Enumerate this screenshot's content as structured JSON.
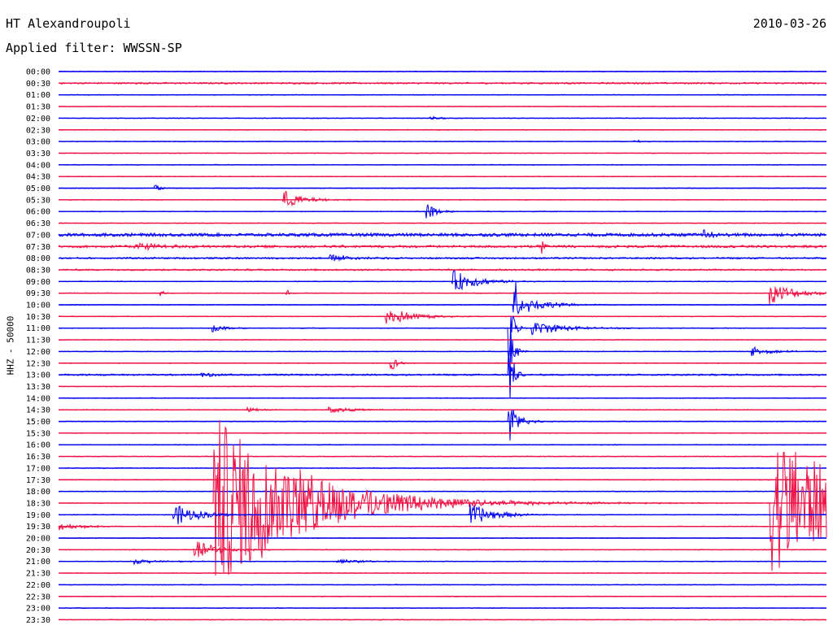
{
  "header": {
    "station": "HT Alexandroupoli",
    "date": "2010-03-26",
    "filter": "Applied filter: WWSSN-SP"
  },
  "channel_label": "HHZ - 50000",
  "colors": {
    "even_trace": "#0000ee",
    "odd_trace": "#ee1144"
  },
  "chart_data": {
    "type": "line",
    "title": "HT Alexandroupoli",
    "xlabel": "",
    "ylabel": "HHZ - 50000",
    "categories": [
      "00:00",
      "00:30",
      "01:00",
      "01:30",
      "02:00",
      "02:30",
      "03:00",
      "03:30",
      "04:00",
      "04:30",
      "05:00",
      "05:30",
      "06:00",
      "06:30",
      "07:00",
      "07:30",
      "08:00",
      "08:30",
      "09:00",
      "09:30",
      "10:00",
      "10:30",
      "11:00",
      "11:30",
      "12:00",
      "12:30",
      "13:00",
      "13:30",
      "14:00",
      "14:30",
      "15:00",
      "15:30",
      "16:00",
      "16:30",
      "17:00",
      "17:30",
      "18:00",
      "18:30",
      "19:00",
      "19:30",
      "20:00",
      "20:30",
      "21:00",
      "21:30",
      "22:00",
      "22:30",
      "23:00",
      "23:30"
    ],
    "trace_minutes": 30,
    "grid": false,
    "noise_level": [
      1,
      2,
      1,
      1,
      1,
      1,
      1,
      1,
      1,
      1,
      1,
      1,
      1,
      1,
      4,
      3,
      2,
      2,
      1,
      1,
      1,
      1,
      1,
      1,
      1,
      1,
      2,
      1,
      1,
      1,
      1,
      1,
      1,
      1,
      1,
      1,
      1,
      1,
      1,
      1,
      1,
      1,
      1,
      1,
      1,
      1,
      1,
      1
    ],
    "events": [
      {
        "trace": "02:00",
        "minute": 14.5,
        "amplitude": 2,
        "duration_min": 1
      },
      {
        "trace": "03:00",
        "minute": 22.5,
        "amplitude": 2,
        "duration_min": 0.5
      },
      {
        "trace": "05:00",
        "minute": 3.8,
        "amplitude": 6,
        "duration_min": 0.2
      },
      {
        "trace": "05:30",
        "minute": 8.8,
        "amplitude": 12,
        "duration_min": 1.5
      },
      {
        "trace": "06:00",
        "minute": 14.4,
        "amplitude": 12,
        "duration_min": 0.6
      },
      {
        "trace": "07:00",
        "minute": 25.2,
        "amplitude": 6,
        "duration_min": 1
      },
      {
        "trace": "07:30",
        "minute": 3.0,
        "amplitude": 6,
        "duration_min": 2
      },
      {
        "trace": "07:30",
        "minute": 18.9,
        "amplitude": 8,
        "duration_min": 0.2
      },
      {
        "trace": "08:00",
        "minute": 10.6,
        "amplitude": 5,
        "duration_min": 2
      },
      {
        "trace": "09:00",
        "minute": 15.4,
        "amplitude": 14,
        "duration_min": 2
      },
      {
        "trace": "09:30",
        "minute": 4.0,
        "amplitude": 5,
        "duration_min": 0.2
      },
      {
        "trace": "09:30",
        "minute": 8.9,
        "amplitude": 5,
        "duration_min": 0.2
      },
      {
        "trace": "09:30",
        "minute": 27.8,
        "amplitude": 14,
        "duration_min": 2
      },
      {
        "trace": "10:00",
        "minute": 17.8,
        "amplitude": 46,
        "duration_min": 0.25
      },
      {
        "trace": "10:00",
        "minute": 18.4,
        "amplitude": 8,
        "duration_min": 2
      },
      {
        "trace": "10:30",
        "minute": 12.8,
        "amplitude": 12,
        "duration_min": 2
      },
      {
        "trace": "11:00",
        "minute": 6.0,
        "amplitude": 5,
        "duration_min": 1
      },
      {
        "trace": "11:00",
        "minute": 17.6,
        "amplitude": 46,
        "duration_min": 0.25
      },
      {
        "trace": "11:00",
        "minute": 18.5,
        "amplitude": 8,
        "duration_min": 3
      },
      {
        "trace": "12:00",
        "minute": 17.6,
        "amplitude": 46,
        "duration_min": 0.25
      },
      {
        "trace": "12:00",
        "minute": 27.1,
        "amplitude": 6,
        "duration_min": 1.5
      },
      {
        "trace": "12:30",
        "minute": 13.0,
        "amplitude": 10,
        "duration_min": 0.4
      },
      {
        "trace": "13:00",
        "minute": 17.6,
        "amplitude": 46,
        "duration_min": 0.25
      },
      {
        "trace": "13:00",
        "minute": 5.6,
        "amplitude": 3,
        "duration_min": 1
      },
      {
        "trace": "14:30",
        "minute": 7.4,
        "amplitude": 3,
        "duration_min": 1
      },
      {
        "trace": "14:30",
        "minute": 10.6,
        "amplitude": 4,
        "duration_min": 2
      },
      {
        "trace": "15:00",
        "minute": 17.6,
        "amplitude": 46,
        "duration_min": 0.25
      },
      {
        "trace": "15:00",
        "minute": 18.0,
        "amplitude": 6,
        "duration_min": 1
      },
      {
        "trace": "18:30",
        "minute": 7.5,
        "amplitude": 20,
        "duration_min": 3
      },
      {
        "trace": "18:30",
        "minute": 6.1,
        "amplitude": 110,
        "duration_min": 7
      },
      {
        "trace": "18:30",
        "minute": 27.8,
        "amplitude": 90,
        "duration_min": 7
      },
      {
        "trace": "19:00",
        "minute": 4.5,
        "amplitude": 14,
        "duration_min": 2
      },
      {
        "trace": "19:00",
        "minute": 16.1,
        "amplitude": 14,
        "duration_min": 2
      },
      {
        "trace": "19:30",
        "minute": 0.0,
        "amplitude": 5,
        "duration_min": 2
      },
      {
        "trace": "20:30",
        "minute": 5.3,
        "amplitude": 12,
        "duration_min": 2
      },
      {
        "trace": "21:00",
        "minute": 3.0,
        "amplitude": 3,
        "duration_min": 2
      },
      {
        "trace": "21:00",
        "minute": 10.9,
        "amplitude": 3,
        "duration_min": 2
      }
    ]
  }
}
